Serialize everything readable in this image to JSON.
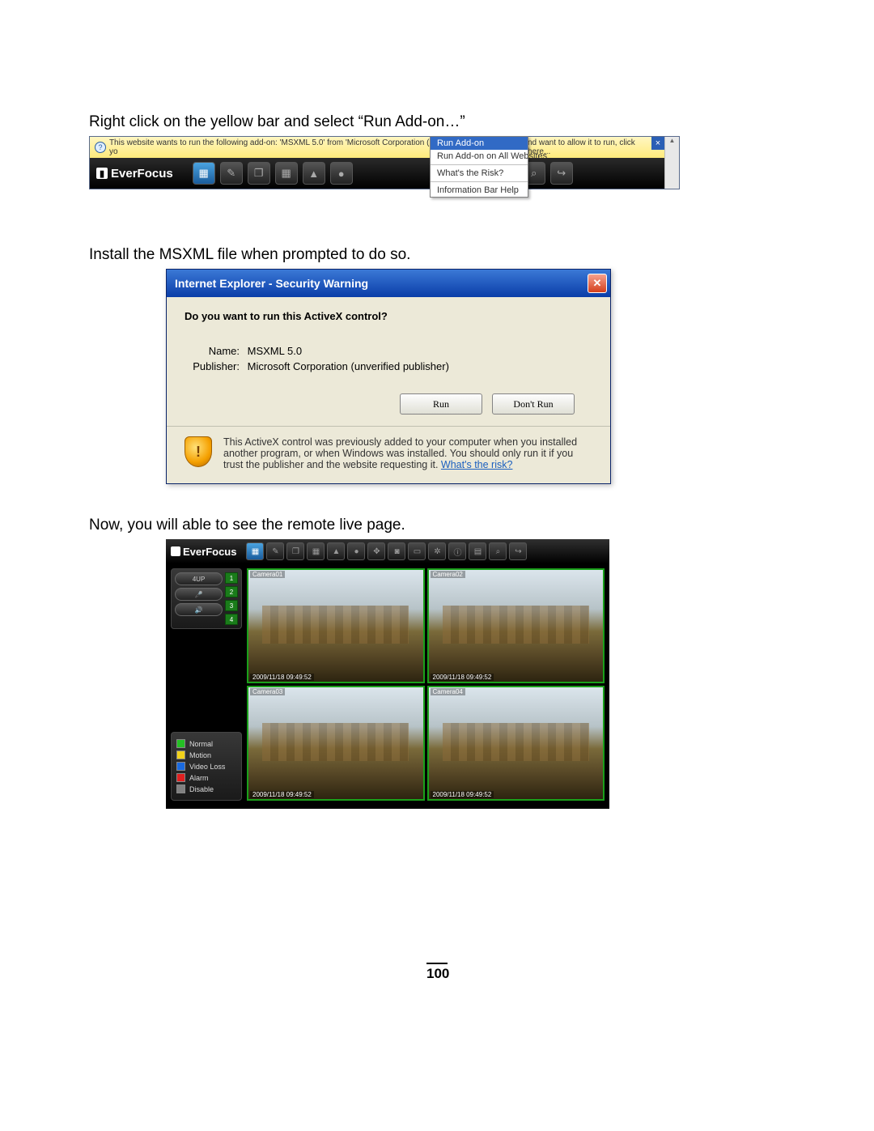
{
  "instructions": {
    "step1": "Right click on the yellow bar and select “Run Add-on…”",
    "step2": "Install the MSXML file when prompted to do so.",
    "step3": "Now, you will able to see the remote live page."
  },
  "infobar": {
    "text_left": "This website wants to run the following add-on: 'MSXML 5.0' from 'Microsoft Corporation (unverified publisher)'. If yo",
    "text_right": "nd want to allow it to run, click here..."
  },
  "context_menu": {
    "items": [
      "Run Add-on",
      "Run Add-on on All Websites",
      "What's the Risk?",
      "Information Bar Help"
    ]
  },
  "brand": "EverFocus",
  "dialog": {
    "title": "Internet Explorer - Security Warning",
    "question": "Do you want to run this ActiveX control?",
    "name_label": "Name:",
    "name_value": "MSXML 5.0",
    "publisher_label": "Publisher:",
    "publisher_value": "Microsoft Corporation (unverified publisher)",
    "run": "Run",
    "dont_run": "Don't Run",
    "footer_text": "This ActiveX control was previously added to your computer when you installed another program, or when Windows was installed. You should only run it if you trust the publisher and the website requesting it.",
    "footer_link": "What's the risk?"
  },
  "live": {
    "view_mode": "4UP",
    "channels": [
      "1",
      "2",
      "3",
      "4"
    ],
    "legend": [
      {
        "color": "#24c024",
        "label": "Normal"
      },
      {
        "color": "#f2d21a",
        "label": "Motion"
      },
      {
        "color": "#1a6ae0",
        "label": "Video Loss"
      },
      {
        "color": "#e02020",
        "label": "Alarm"
      },
      {
        "color": "#808080",
        "label": "Disable"
      }
    ],
    "cameras": [
      {
        "name": "Camera01",
        "ts": "2009/11/18 09:49:52"
      },
      {
        "name": "Camera02",
        "ts": "2009/11/18 09:49:52"
      },
      {
        "name": "Camera03",
        "ts": "2009/11/18 09:49:52"
      },
      {
        "name": "Camera04",
        "ts": "2009/11/18 09:49:52"
      }
    ]
  },
  "page_number": "100"
}
